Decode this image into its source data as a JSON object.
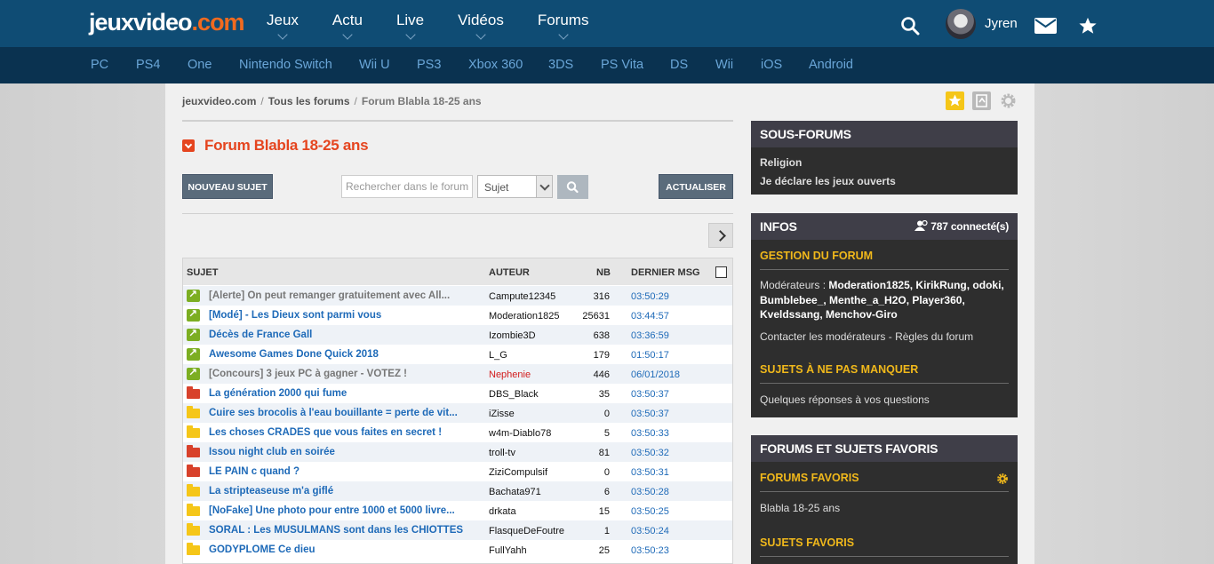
{
  "header": {
    "logo_main": "jeuxvideo",
    "logo_suffix": ".com",
    "nav": [
      "Jeux",
      "Actu",
      "Live",
      "Vidéos",
      "Forums"
    ],
    "username": "Jyren"
  },
  "platforms": [
    "PC",
    "PS4",
    "One",
    "Nintendo Switch",
    "Wii U",
    "PS3",
    "Xbox 360",
    "3DS",
    "PS Vita",
    "DS",
    "Wii",
    "iOS",
    "Android"
  ],
  "breadcrumb": {
    "home": "jeuxvideo.com",
    "forums": "Tous les forums",
    "current": "Forum Blabla 18-25 ans"
  },
  "forum": {
    "title": "Forum Blabla 18-25 ans",
    "new_topic_label": "NOUVEAU SUJET",
    "search_placeholder": "Rechercher dans le forum",
    "search_scope": "Sujet",
    "refresh_label": "ACTUALISER"
  },
  "table": {
    "headers": {
      "subject": "SUJET",
      "author": "AUTEUR",
      "count": "NB",
      "last": "DERNIER MSG"
    },
    "rows": [
      {
        "icon": "pin",
        "subject": "[Alerte] On peut remanger gratuitement avec All...",
        "author": "Campute12345",
        "nb": "316",
        "last": "03:50:29"
      },
      {
        "icon": "pin",
        "subject": "[Modé] - Les Dieux sont parmi vous",
        "author": "Moderation1825",
        "nb": "25631",
        "last": "03:44:57"
      },
      {
        "icon": "pin",
        "subject": "Décès de France Gall",
        "author": "Izombie3D",
        "nb": "638",
        "last": "03:36:59"
      },
      {
        "icon": "pin",
        "subject": "Awesome Games Done Quick 2018",
        "author": "L_G",
        "nb": "179",
        "last": "01:50:17"
      },
      {
        "icon": "pin",
        "subject": "[Concours] 3 jeux PC à gagner - VOTEZ !",
        "author": "Nephenie",
        "nb": "446",
        "last": "06/01/2018"
      },
      {
        "icon": "red",
        "subject": "La génération 2000 qui fume",
        "author": "DBS_Black",
        "nb": "35",
        "last": "03:50:37"
      },
      {
        "icon": "yellow",
        "subject": "Cuire ses brocolis à l'eau bouillante = perte de vit...",
        "author": "iZisse",
        "nb": "0",
        "last": "03:50:37"
      },
      {
        "icon": "yellow",
        "subject": "Les choses CRADES que vous faites en secret !",
        "author": "w4m-Diablo78",
        "nb": "5",
        "last": "03:50:33"
      },
      {
        "icon": "red",
        "subject": "Issou night club en soirée",
        "author": "troll-tv",
        "nb": "81",
        "last": "03:50:32"
      },
      {
        "icon": "red",
        "subject": "LE PAIN c quand ?",
        "author": "ZiziCompulsif",
        "nb": "0",
        "last": "03:50:31"
      },
      {
        "icon": "yellow",
        "subject": "La stripteaseuse m'a giflé",
        "author": "Bachata971",
        "nb": "6",
        "last": "03:50:28"
      },
      {
        "icon": "yellow",
        "subject": "[NoFake] Une photo pour entre 1000 et 5000 livre...",
        "author": "drkata",
        "nb": "15",
        "last": "03:50:25"
      },
      {
        "icon": "yellow",
        "subject": "SORAL : Les MUSULMANS sont dans les CHIOTTES",
        "author": "FlasqueDeFoutre",
        "nb": "1",
        "last": "03:50:24"
      },
      {
        "icon": "yellow",
        "subject": "GODYPLOME Ce dieu",
        "author": "FullYahh",
        "nb": "25",
        "last": "03:50:23"
      }
    ]
  },
  "sidebar": {
    "subforums": {
      "title": "SOUS-FORUMS",
      "items": [
        "Religion",
        "Je déclare les jeux ouverts"
      ]
    },
    "infos": {
      "title": "INFOS",
      "connected": "787 connecté(s)",
      "management_title": "GESTION DU FORUM",
      "moderators_label": "Modérateurs :",
      "moderators": "Moderation1825, KirikRung, odoki, Bumblebee_, Menthe_a_H2O, Player360, Kveldssang, Menchov-Giro",
      "contact": "Contacter les modérateurs",
      "rules": "Règles du forum",
      "must_title": "SUJETS À NE PAS MANQUER",
      "must_text": "Quelques réponses à vos questions"
    },
    "favorites": {
      "title": "FORUMS ET SUJETS FAVORIS",
      "forums_title": "FORUMS FAVORIS",
      "forum_item": "Blabla 18-25 ans",
      "topics_title": "SUJETS FAVORIS"
    }
  }
}
